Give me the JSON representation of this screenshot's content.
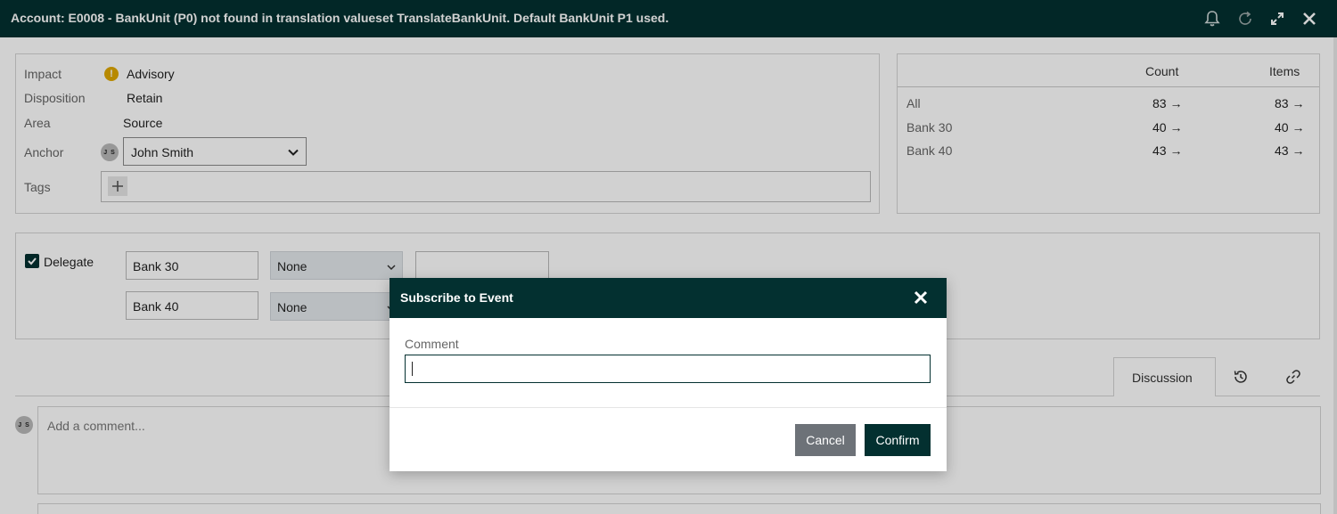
{
  "window": {
    "title": "Account: E0008 - BankUnit (P0) not found in translation valueset TranslateBankUnit. Default BankUnit P1 used.",
    "icons": [
      "bell-icon",
      "refresh-icon",
      "expand-icon",
      "close-icon"
    ]
  },
  "details": {
    "impact_label": "Impact",
    "impact_value": "Advisory",
    "impact_icon": "warning-icon",
    "disposition_label": "Disposition",
    "disposition_value": "Retain",
    "area_label": "Area",
    "area_value": "Source",
    "anchor_label": "Anchor",
    "anchor_initials": "J S",
    "anchor_value": "John Smith",
    "tags_label": "Tags"
  },
  "counts_table": {
    "headers": [
      "Count",
      "Items"
    ],
    "rows": [
      {
        "label": "All",
        "count": "83 →",
        "items": "83 →"
      },
      {
        "label": "Bank 30",
        "count": "40 →",
        "items": "40 →"
      },
      {
        "label": "Bank 40",
        "count": "43 →",
        "items": "43 →"
      }
    ]
  },
  "delegate": {
    "checked": true,
    "label": "Delegate",
    "rows": [
      {
        "bank": "Bank 30",
        "option": "None"
      },
      {
        "bank": "Bank 40",
        "option": "None"
      }
    ]
  },
  "tabs": {
    "discussion_label": "Discussion",
    "icons": [
      "history-icon",
      "link-icon"
    ]
  },
  "comment": {
    "initials": "J S",
    "placeholder": "Add a comment..."
  },
  "modal": {
    "title": "Subscribe to Event",
    "field_label": "Comment",
    "field_value": "",
    "cancel_label": "Cancel",
    "confirm_label": "Confirm"
  },
  "colors": {
    "brand_dark": "#033030",
    "warning": "#e0a800",
    "cancel_gray": "#6d7278"
  }
}
